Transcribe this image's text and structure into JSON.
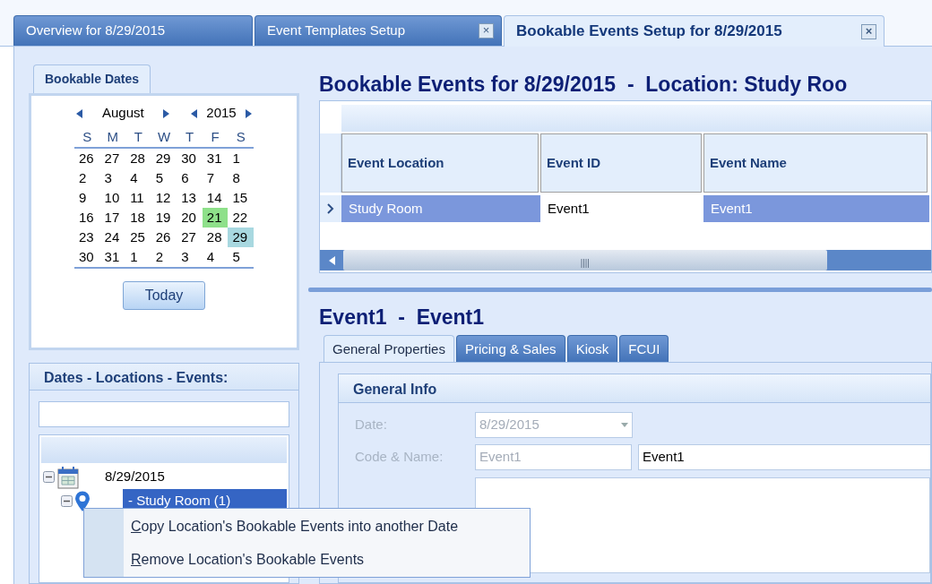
{
  "document_tabs": [
    {
      "label": "Overview for 8/29/2015",
      "selected": false,
      "closable": false
    },
    {
      "label": "Event Templates Setup",
      "selected": false,
      "closable": true
    },
    {
      "label": "Bookable Events Setup for 8/29/2015",
      "selected": true,
      "closable": true
    }
  ],
  "close_glyph": "×",
  "calendar": {
    "title": "Bookable Dates",
    "month": "August",
    "year": "2015",
    "weekdays": [
      "S",
      "M",
      "T",
      "W",
      "T",
      "F",
      "S"
    ],
    "weeks": [
      [
        {
          "day": "26"
        },
        {
          "day": "27"
        },
        {
          "day": "28"
        },
        {
          "day": "29"
        },
        {
          "day": "30"
        },
        {
          "day": "31"
        },
        {
          "day": "1"
        }
      ],
      [
        {
          "day": "2"
        },
        {
          "day": "3"
        },
        {
          "day": "4"
        },
        {
          "day": "5"
        },
        {
          "day": "6"
        },
        {
          "day": "7"
        },
        {
          "day": "8"
        }
      ],
      [
        {
          "day": "9"
        },
        {
          "day": "10"
        },
        {
          "day": "11"
        },
        {
          "day": "12"
        },
        {
          "day": "13"
        },
        {
          "day": "14"
        },
        {
          "day": "15"
        }
      ],
      [
        {
          "day": "16"
        },
        {
          "day": "17"
        },
        {
          "day": "18"
        },
        {
          "day": "19"
        },
        {
          "day": "20"
        },
        {
          "day": "21",
          "color": "#8ee08a"
        },
        {
          "day": "22"
        }
      ],
      [
        {
          "day": "23"
        },
        {
          "day": "24"
        },
        {
          "day": "25"
        },
        {
          "day": "26"
        },
        {
          "day": "27"
        },
        {
          "day": "28"
        },
        {
          "day": "29",
          "color": "#a8d8e0"
        }
      ],
      [
        {
          "day": "30"
        },
        {
          "day": "31"
        },
        {
          "day": "1"
        },
        {
          "day": "2"
        },
        {
          "day": "3"
        },
        {
          "day": "4"
        },
        {
          "day": "5"
        }
      ]
    ],
    "today_button": "Today"
  },
  "tree_panel": {
    "title": "Dates - Locations - Events:",
    "tree": [
      {
        "label": "8/29/2015",
        "kind": "date",
        "expanded": true,
        "selected": false,
        "children": [
          {
            "label": "- Study Room (1)",
            "kind": "location",
            "expanded": true,
            "selected": true
          }
        ]
      }
    ]
  },
  "context_menu": [
    {
      "label": "Copy Location's Bookable Events into another Date"
    },
    {
      "label": "Remove Location's Bookable Events"
    }
  ],
  "events_title": "Bookable Events for 8/29/2015  -  Location: Study Roo",
  "events_grid": {
    "columns": [
      "Event Location",
      "Event ID",
      "Event Name"
    ],
    "rows": [
      {
        "selected": true,
        "cells": [
          {
            "text": "Study Room",
            "focused": false
          },
          {
            "text": "Event1",
            "focused": true
          },
          {
            "text": "Event1",
            "focused": false
          }
        ]
      }
    ]
  },
  "detail_title": "Event1  -  Event1",
  "detail_tabs": [
    {
      "label": "General Properties",
      "selected": true
    },
    {
      "label": "Pricing & Sales",
      "selected": false
    },
    {
      "label": "Kiosk",
      "selected": false
    },
    {
      "label": "FCUI",
      "selected": false
    }
  ],
  "general_info": {
    "title": "General Info",
    "date": {
      "label": "Date:",
      "value": "8/29/2015",
      "disabled": true
    },
    "code_name": {
      "label": "Code & Name:",
      "code": "Event1",
      "code_disabled": true,
      "name": "Event1",
      "name_disabled": false
    }
  }
}
